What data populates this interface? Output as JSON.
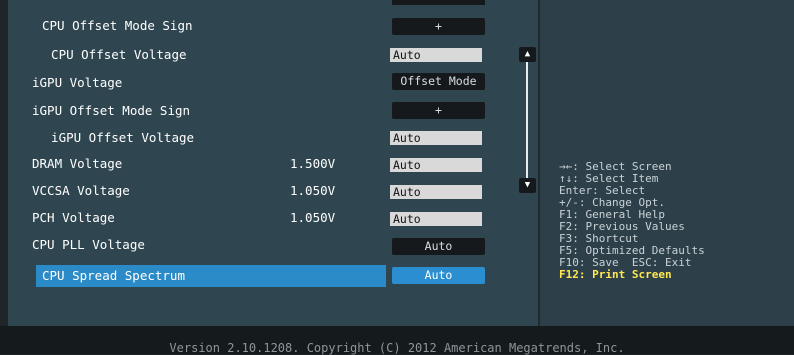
{
  "settings": [
    {
      "label": "CPU Offset Mode Sign",
      "value": "",
      "control": "button",
      "ctrl_value": "+"
    },
    {
      "label": "  CPU Offset Voltage",
      "value": "",
      "control": "field",
      "ctrl_value": "Auto"
    },
    {
      "label": "iGPU Voltage",
      "value": "",
      "control": "button",
      "ctrl_value": "Offset Mode"
    },
    {
      "label": "iGPU Offset Mode Sign",
      "value": "",
      "control": "button",
      "ctrl_value": "+"
    },
    {
      "label": "  iGPU Offset Voltage",
      "value": "",
      "control": "field",
      "ctrl_value": "Auto"
    },
    {
      "label": "DRAM Voltage",
      "value": "1.500V",
      "control": "field",
      "ctrl_value": "Auto"
    },
    {
      "label": "VCCSA Voltage",
      "value": "1.050V",
      "control": "field",
      "ctrl_value": "Auto"
    },
    {
      "label": "PCH Voltage",
      "value": "1.050V",
      "control": "field",
      "ctrl_value": "Auto"
    },
    {
      "label": "CPU PLL Voltage",
      "value": "",
      "control": "button",
      "ctrl_value": "Auto"
    },
    {
      "label": "CPU Spread Spectrum",
      "value": "",
      "control": "button",
      "ctrl_value": "Auto"
    }
  ],
  "scrollbar": {
    "up_glyph": "▲",
    "down_glyph": "▼"
  },
  "help": [
    "→←: Select Screen",
    "↑↓: Select Item",
    "Enter: Select",
    "+/-: Change Opt.",
    "F1: General Help",
    "F2: Previous Values",
    "F3: Shortcut",
    "F5: Optimized Defaults",
    "F10: Save  ESC: Exit"
  ],
  "help_highlight": "F12: Print Screen",
  "footer": "Version 2.10.1208. Copyright (C) 2012 American Megatrends, Inc.",
  "colors": {
    "selected_row": "#2a8bc8",
    "highlight_text": "#ffe84f",
    "panel_bg": "#2f4650"
  }
}
